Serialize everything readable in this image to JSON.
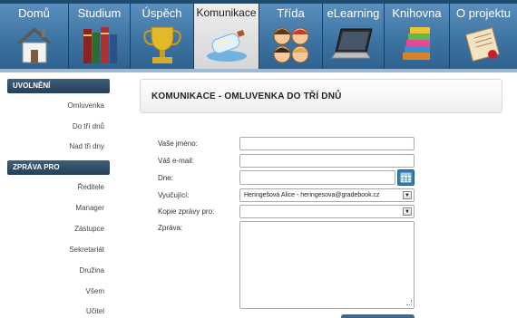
{
  "nav": {
    "tabs": [
      {
        "label": "Domů",
        "icon": "house-icon",
        "active": false
      },
      {
        "label": "Studium",
        "icon": "books-icon",
        "active": false
      },
      {
        "label": "Úspěch",
        "icon": "trophy-icon",
        "active": false
      },
      {
        "label": "Komunikace",
        "icon": "message-bottle-icon",
        "active": true
      },
      {
        "label": "Třída",
        "icon": "students-icon",
        "active": false
      },
      {
        "label": "eLearning",
        "icon": "laptop-icon",
        "active": false
      },
      {
        "label": "Knihovna",
        "icon": "library-books-icon",
        "active": false
      },
      {
        "label": "O projektu",
        "icon": "scroll-icon",
        "active": false
      }
    ]
  },
  "sidebar": {
    "sections": [
      {
        "title": "UVOLNĚNÍ",
        "items": [
          "Omluvenka",
          "Do tří dnů",
          "Nad tři dny"
        ]
      },
      {
        "title": "ZPRÁVA PRO",
        "items": [
          "Ředitele",
          "Manager",
          "Zástupce",
          "Sekretariát",
          "Družina",
          "Všem",
          "Učitel"
        ]
      }
    ]
  },
  "main": {
    "title": "KOMUNIKACE - OMLUVENKA DO TŘÍ DNŮ",
    "form": {
      "name_label": "Vaše jméno:",
      "name_value": "",
      "email_label": "Váš e-mail:",
      "email_value": "",
      "date_label": "Dne:",
      "date_value": "",
      "teacher_label": "Vyučující:",
      "teacher_value": "Heringešová Alice - heringesova@gradebook.cz",
      "copy_label": "Kopie zprávy pro:",
      "copy_value": "",
      "message_label": "Zpráva:",
      "message_value": ""
    }
  },
  "colors": {
    "nav_bg": "#1e4a6e",
    "tab_blue": "#3e74a3",
    "tab_active": "#e2e2e2",
    "sidebar_header": "#2c4a63",
    "date_button": "#2f7fb5"
  }
}
